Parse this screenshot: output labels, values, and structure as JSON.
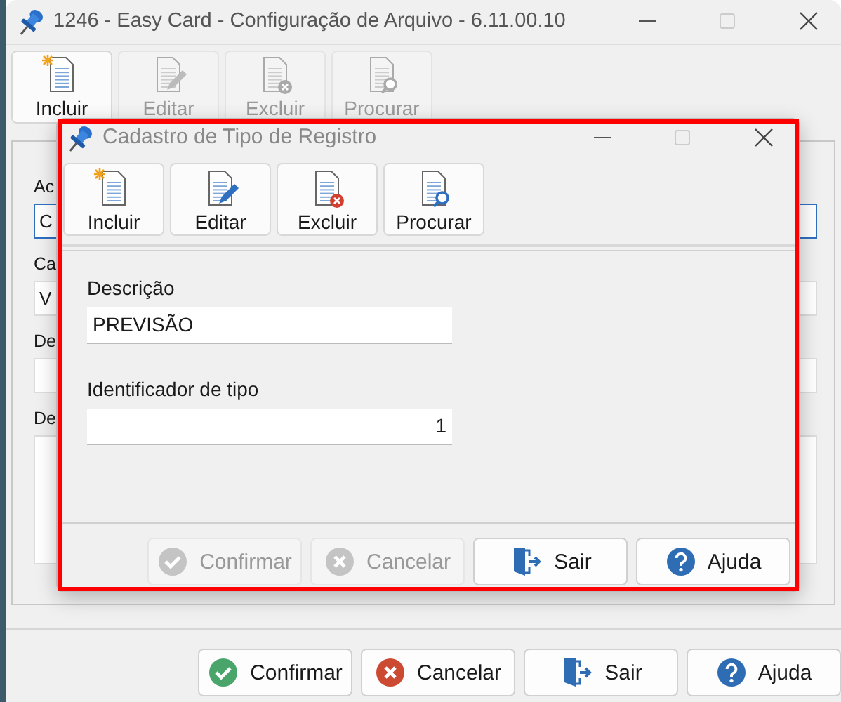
{
  "window": {
    "title": "1246 - Easy Card - Configuração de Arquivo - 6.11.00.10"
  },
  "toolbar": [
    {
      "kind": "new",
      "label": "Incluir",
      "disabled": false
    },
    {
      "kind": "edit",
      "label": "Editar",
      "disabled": true
    },
    {
      "kind": "delete",
      "label": "Excluir",
      "disabled": true
    },
    {
      "kind": "search",
      "label": "Procurar",
      "disabled": true
    }
  ],
  "form": {
    "fields": [
      {
        "kind": "line",
        "label": "Ac",
        "value": "C",
        "focused": true
      },
      {
        "kind": "line",
        "label": "Ca",
        "value": "V",
        "focused": false
      },
      {
        "kind": "line",
        "label": "De",
        "focused": false
      },
      {
        "kind": "memo",
        "label": "De",
        "focused": false
      }
    ]
  },
  "buttons": [
    {
      "kind": "confirm",
      "label": "Confirmar",
      "disabled": false
    },
    {
      "kind": "cancel",
      "label": "Cancelar",
      "disabled": false
    },
    {
      "kind": "exit",
      "label": "Sair",
      "disabled": false
    },
    {
      "kind": "help",
      "label": "Ajuda",
      "disabled": false
    }
  ],
  "dialog": {
    "title": "Cadastro de Tipo de Registro",
    "highlighted": true,
    "toolbar": [
      {
        "kind": "new",
        "label": "Incluir",
        "disabled": false
      },
      {
        "kind": "edit",
        "label": "Editar",
        "disabled": false
      },
      {
        "kind": "delete",
        "label": "Excluir",
        "disabled": false
      },
      {
        "kind": "search",
        "label": "Procurar",
        "disabled": false
      }
    ],
    "fields": [
      {
        "kind": "text",
        "label": "Descrição",
        "value": "PREVISÃO"
      },
      {
        "kind": "number",
        "label": "Identificador de tipo",
        "value": "1"
      }
    ],
    "buttons": [
      {
        "kind": "confirm",
        "label": "Confirmar",
        "disabled": true
      },
      {
        "kind": "cancel",
        "label": "Cancelar",
        "disabled": true
      },
      {
        "kind": "exit",
        "label": "Sair",
        "disabled": false
      },
      {
        "kind": "help",
        "label": "Ajuda",
        "disabled": false
      }
    ]
  }
}
